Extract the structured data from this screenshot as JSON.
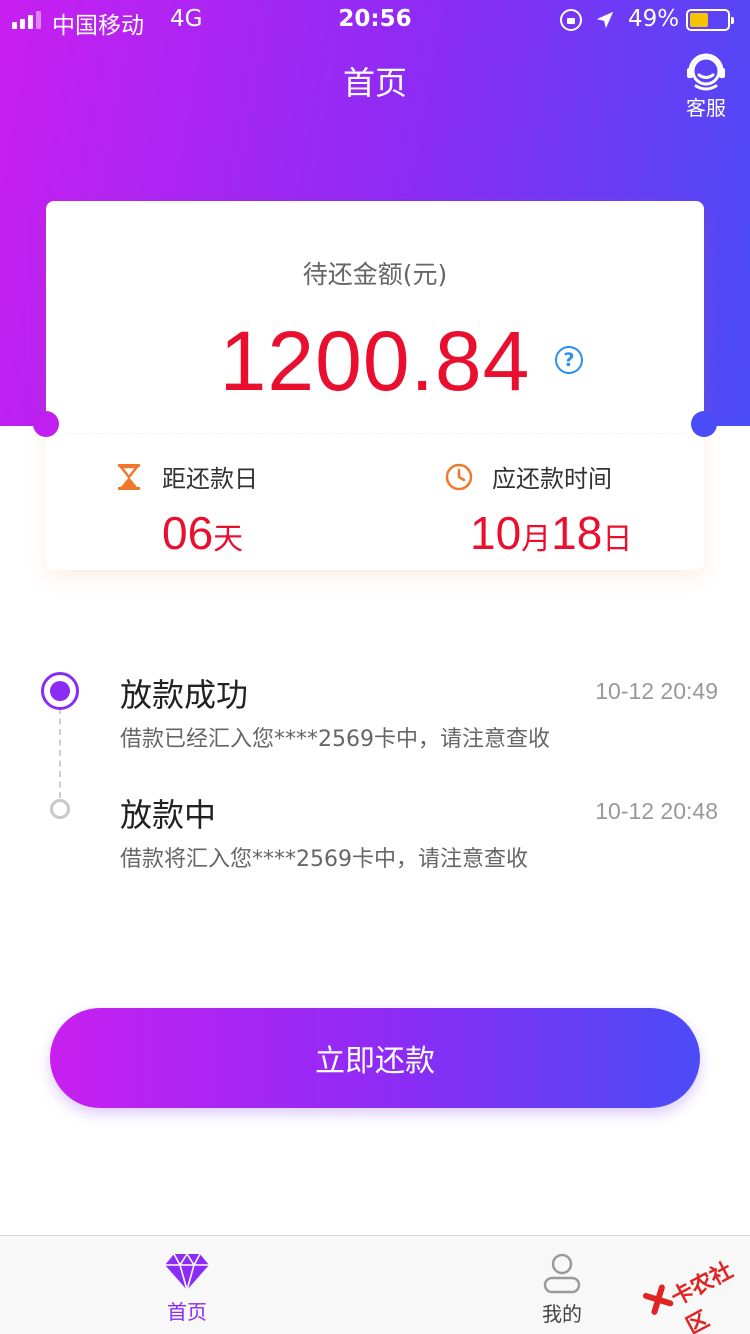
{
  "status_bar": {
    "carrier": "中国移动",
    "network": "4G",
    "time": "20:56",
    "battery": "49%",
    "battery_level": 0.49
  },
  "header": {
    "title": "首页",
    "service_label": "客服"
  },
  "card": {
    "amount_label": "待还金额(元)",
    "amount": "1200.84",
    "help": "?",
    "days_label": "距还款日",
    "days_value": "06",
    "days_unit": "天",
    "due_label": "应还款时间",
    "due_month": "10",
    "due_month_unit": "月",
    "due_day": "18",
    "due_day_unit": "日"
  },
  "timeline": [
    {
      "title": "放款成功",
      "time": "10-12 20:49",
      "desc": "借款已经汇入您****2569卡中，请注意查收"
    },
    {
      "title": "放款中",
      "time": "10-12 20:48",
      "desc": "借款将汇入您****2569卡中，请注意查收"
    }
  ],
  "action": {
    "repay_label": "立即还款"
  },
  "tabbar": [
    {
      "label": "首页",
      "icon": "diamond-icon",
      "active": true
    },
    {
      "label": "我的",
      "icon": "user-icon",
      "active": false
    }
  ],
  "watermark": {
    "text": "卡农社区"
  },
  "colors": {
    "gradient_start": "#c81ff0",
    "gradient_end": "#4a4cf7",
    "accent": "#8a2cf5",
    "amount_red": "#e8102e",
    "icon_orange": "#f0782a",
    "help_blue": "#2a8ff0"
  }
}
